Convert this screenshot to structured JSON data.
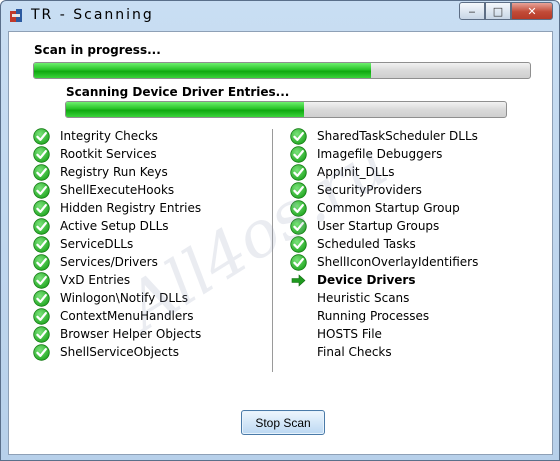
{
  "window": {
    "title": "TR  - Scanning"
  },
  "caption": {
    "minimize": "‒",
    "maximize": "□",
    "close": "✕"
  },
  "status": {
    "scan_label": "Scan in progress...",
    "sub_label": "Scanning Device Driver Entries..."
  },
  "progress": {
    "main": 0.68,
    "sub": 0.54
  },
  "colors": {
    "check": "#1fa51f",
    "arrow": "#1f9a1f",
    "bar_fill": "#22c022"
  },
  "left_items": [
    {
      "label": "Integrity Checks",
      "state": "done"
    },
    {
      "label": "Rootkit Services",
      "state": "done"
    },
    {
      "label": "Registry Run Keys",
      "state": "done"
    },
    {
      "label": "ShellExecuteHooks",
      "state": "done"
    },
    {
      "label": "Hidden Registry Entries",
      "state": "done"
    },
    {
      "label": "Active Setup DLLs",
      "state": "done"
    },
    {
      "label": "ServiceDLLs",
      "state": "done"
    },
    {
      "label": "Services/Drivers",
      "state": "done"
    },
    {
      "label": "VxD Entries",
      "state": "done"
    },
    {
      "label": "Winlogon\\Notify DLLs",
      "state": "done"
    },
    {
      "label": "ContextMenuHandlers",
      "state": "done"
    },
    {
      "label": "Browser Helper Objects",
      "state": "done"
    },
    {
      "label": "ShellServiceObjects",
      "state": "done"
    }
  ],
  "right_items": [
    {
      "label": "SharedTaskScheduler DLLs",
      "state": "done"
    },
    {
      "label": "Imagefile Debuggers",
      "state": "done"
    },
    {
      "label": "AppInit_DLLs",
      "state": "done"
    },
    {
      "label": "SecurityProviders",
      "state": "done"
    },
    {
      "label": "Common Startup Group",
      "state": "done"
    },
    {
      "label": "User Startup Groups",
      "state": "done"
    },
    {
      "label": "Scheduled Tasks",
      "state": "done"
    },
    {
      "label": "ShellIconOverlayIdentifiers",
      "state": "done"
    },
    {
      "label": "Device Drivers",
      "state": "current"
    },
    {
      "label": "Heuristic Scans",
      "state": "pending"
    },
    {
      "label": "Running Processes",
      "state": "pending"
    },
    {
      "label": "HOSTS File",
      "state": "pending"
    },
    {
      "label": "Final Checks",
      "state": "pending"
    }
  ],
  "watermark": "All4os.ru",
  "buttons": {
    "stop": "Stop Scan"
  }
}
